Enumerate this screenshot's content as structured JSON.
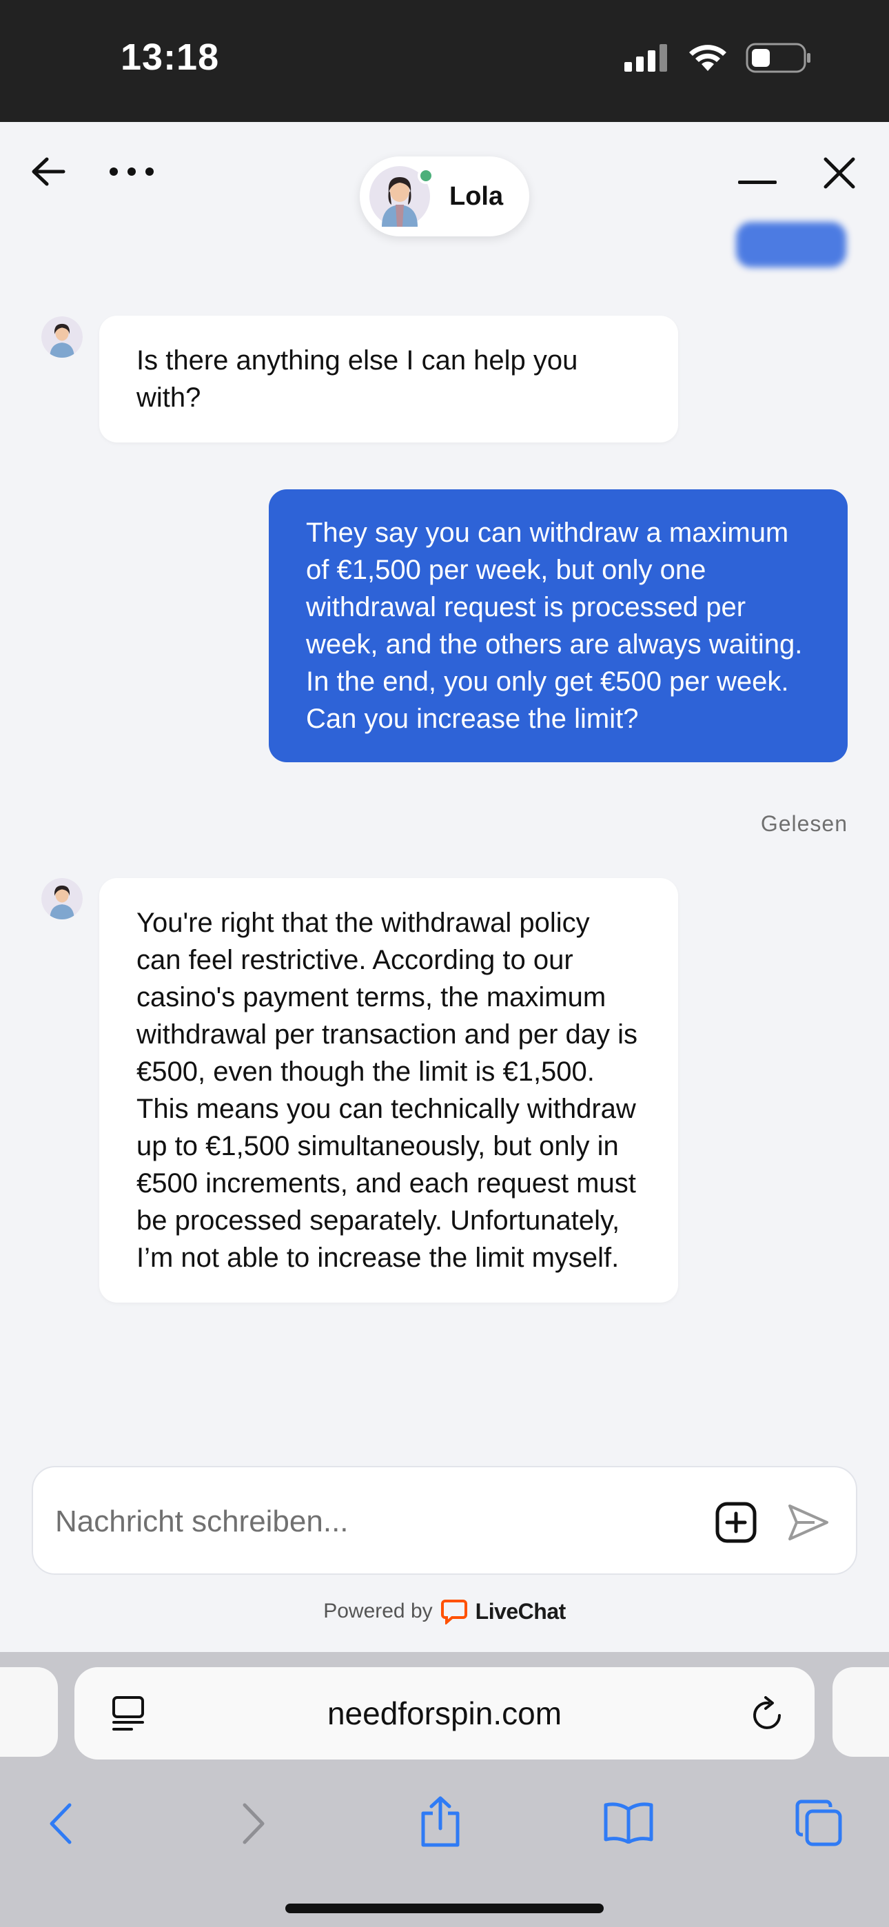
{
  "status_bar": {
    "time": "13:18",
    "icons": [
      "signal-icon",
      "wifi-icon",
      "battery-icon"
    ]
  },
  "chat_header": {
    "agent_name": "Lola",
    "agent_status": "online",
    "icons": [
      "back-arrow-icon",
      "more-options-icon",
      "minimize-icon",
      "close-icon"
    ]
  },
  "messages": [
    {
      "sender": "agent",
      "text": "Is there anything else I can help you with?"
    },
    {
      "sender": "user",
      "text": "They say you can withdraw a maximum of €1,500 per week, but only one withdrawal request is processed per week, and the others are always waiting. In the end, you only get €500 per week. Can you increase the limit?",
      "receipt": "Gelesen"
    },
    {
      "sender": "agent",
      "text": "You're right that the withdrawal policy can feel restrictive. According to our casino's payment terms, the maximum withdrawal per transaction and per day is €500, even though the limit is €1,500. This means you can technically withdraw up to €1,500 simultaneously, but only in €500 increments, and each request must be processed separately. Unfortunately, I’m not able to increase the limit myself."
    }
  ],
  "composer": {
    "placeholder": "Nachricht schreiben...",
    "value": "",
    "icons": [
      "attachment-plus-icon",
      "send-icon"
    ]
  },
  "footer": {
    "powered_by": "Powered by",
    "brand": "LiveChat"
  },
  "browser": {
    "url": "needforspin.com",
    "icons": [
      "reader-icon",
      "reload-icon",
      "back-icon",
      "forward-icon",
      "share-icon",
      "bookmarks-icon",
      "tabs-icon"
    ]
  },
  "colors": {
    "accent": "#2e63d7",
    "background": "#f3f4f7",
    "safari_blue": "#2f7bf5",
    "livechat_orange": "#ff5100"
  }
}
